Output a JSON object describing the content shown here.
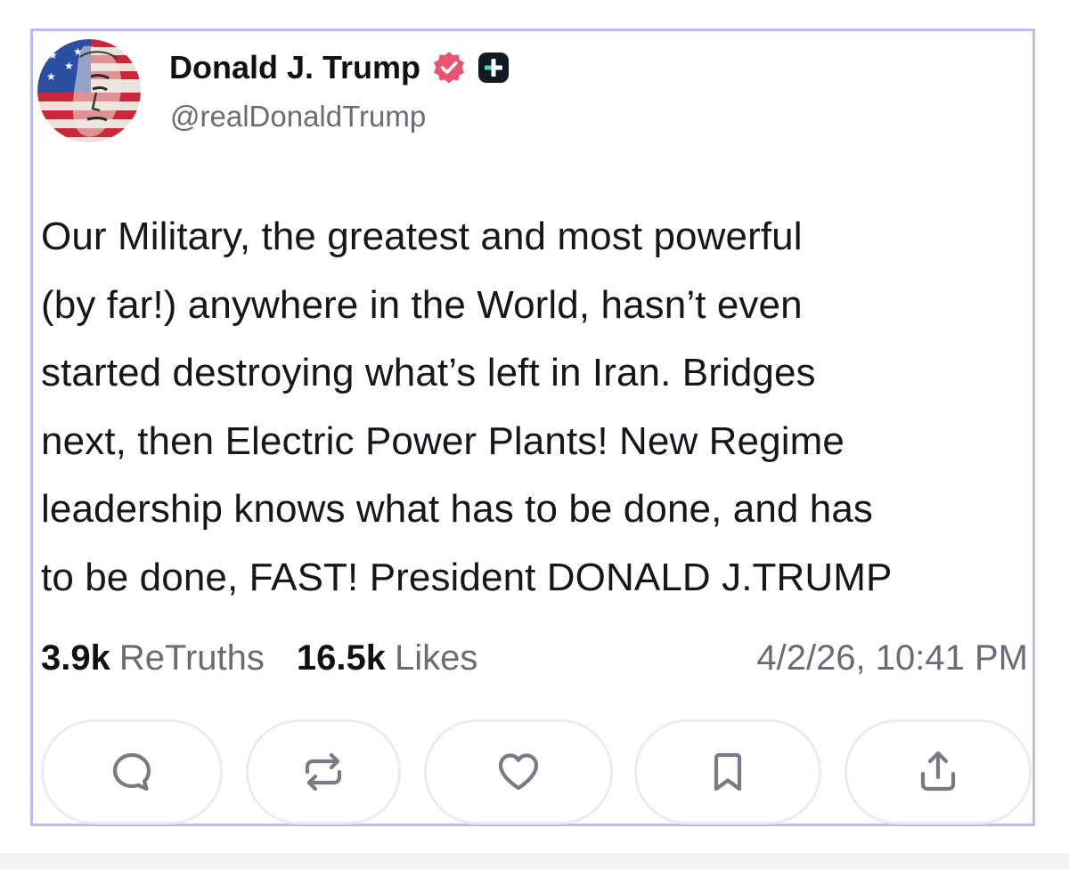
{
  "author": {
    "name": "Donald J. Trump",
    "handle": "@realDonaldTrump",
    "verified_icon": "verified-badge-icon",
    "subscription_icon": "plus-badge-icon"
  },
  "post": {
    "lines": [
      "Our Military, the greatest and most powerful",
      "(by far!) anywhere in the World, hasn’t even",
      "started destroying what’s left in Iran. Bridges",
      "next, then Electric Power Plants! New Regime",
      "leadership knows what has to be done, and has",
      "to be done, FAST! President DONALD J.TRUMP"
    ]
  },
  "stats": {
    "retruths_count": "3.9k",
    "retruths_label": "ReTruths",
    "likes_count": "16.5k",
    "likes_label": "Likes",
    "timestamp": "4/2/26, 10:41 PM"
  },
  "actions": [
    {
      "name": "reply",
      "icon": "reply-icon"
    },
    {
      "name": "retruth",
      "icon": "retruth-icon"
    },
    {
      "name": "like",
      "icon": "heart-icon"
    },
    {
      "name": "bookmark",
      "icon": "bookmark-icon"
    },
    {
      "name": "share",
      "icon": "share-icon"
    }
  ],
  "colors": {
    "card_border": "#b9bdf0",
    "verified_badge": "#e8556e",
    "muted_text": "#6b6b78",
    "icon_stroke": "#7a7a86"
  }
}
